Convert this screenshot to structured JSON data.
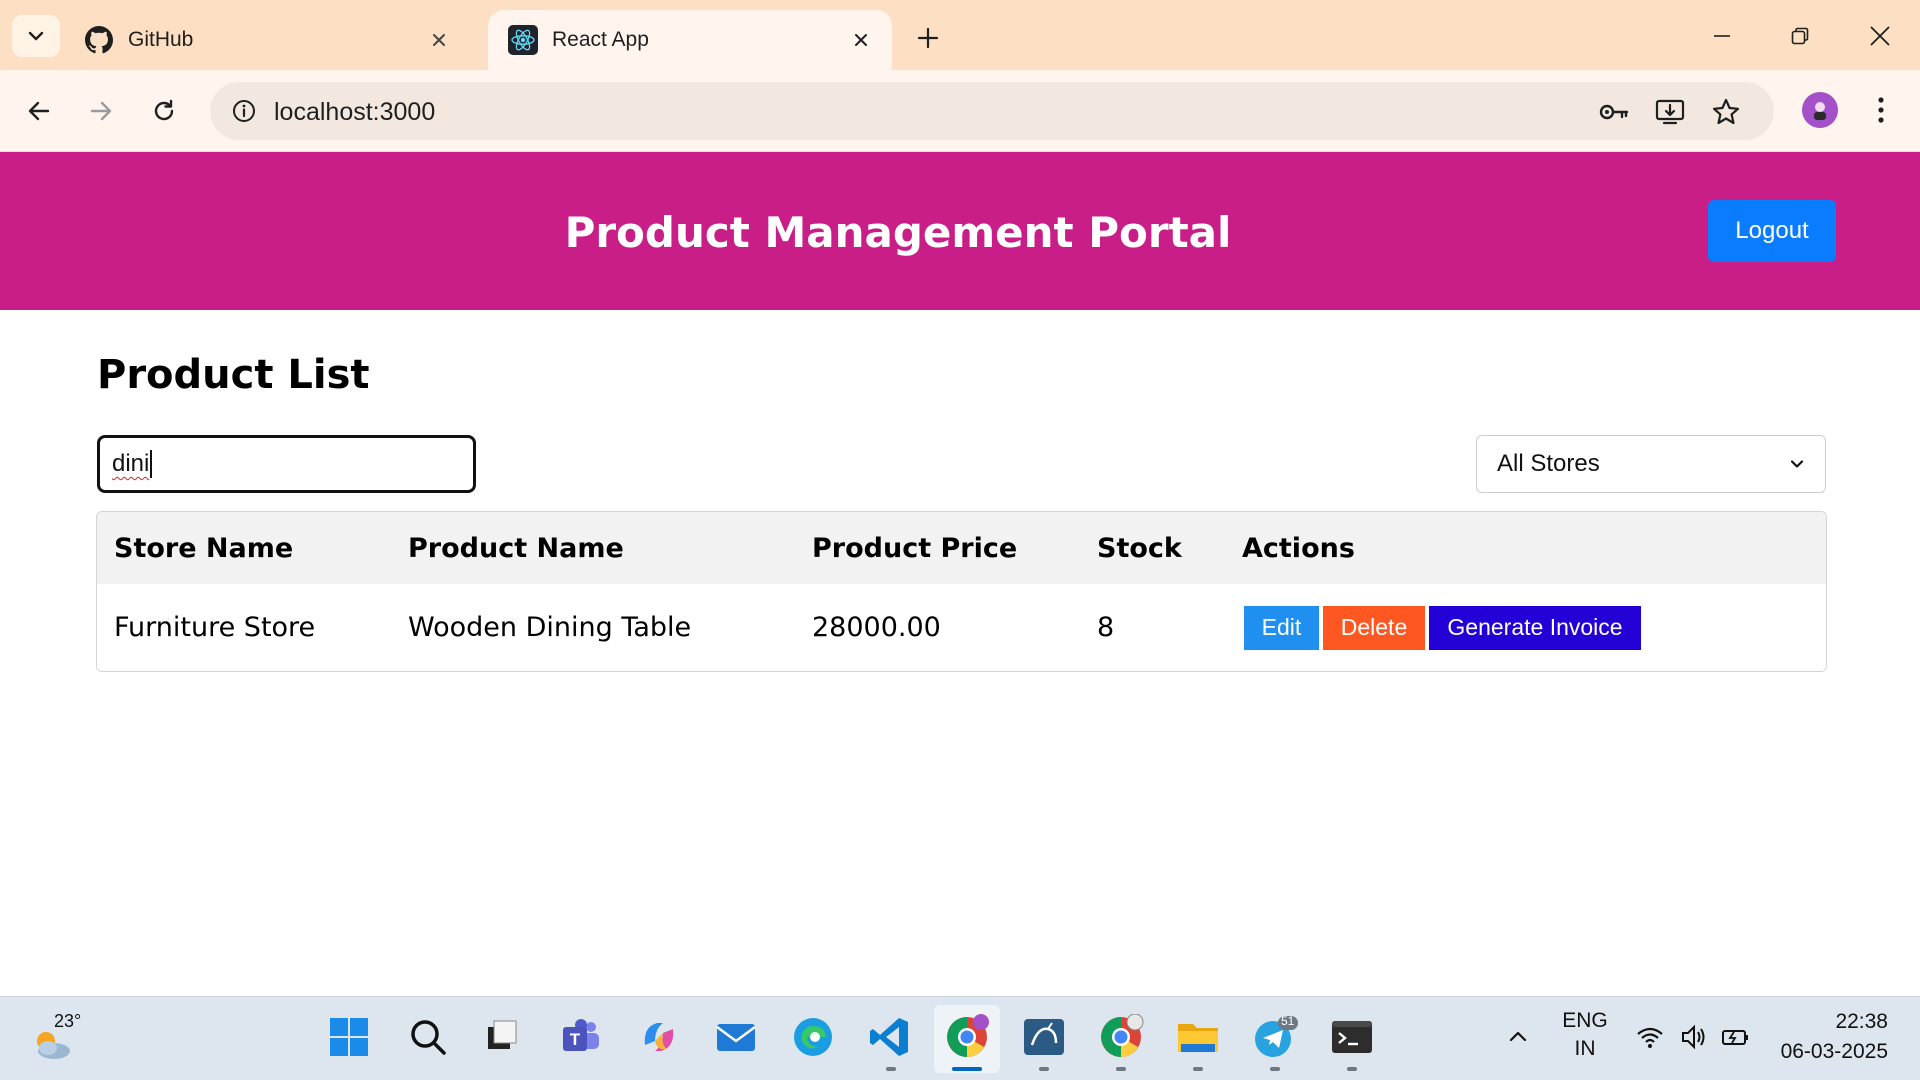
{
  "browser": {
    "tabs": [
      {
        "title": "GitHub",
        "icon": "github-icon",
        "active": false
      },
      {
        "title": "React App",
        "icon": "react-icon",
        "active": true
      }
    ],
    "url": "localhost:3000",
    "colors": {
      "tabbar": "#fde0c3",
      "toolbar": "#fff5ee"
    }
  },
  "header": {
    "title": "Product Management Portal",
    "logout_label": "Logout",
    "colors": {
      "background": "#c91e87",
      "logout": "#0a7cff"
    }
  },
  "main": {
    "heading": "Product List",
    "search": {
      "value": "dini",
      "placeholder": ""
    },
    "store_filter": {
      "selected": "All Stores"
    },
    "table": {
      "columns": [
        "Store Name",
        "Product Name",
        "Product Price",
        "Stock",
        "Actions"
      ],
      "rows": [
        {
          "store": "Furniture Store",
          "product": "Wooden Dining Table",
          "price": "28000.00",
          "stock": "8",
          "actions": {
            "edit": "Edit",
            "delete": "Delete",
            "invoice": "Generate Invoice"
          }
        }
      ]
    },
    "colors": {
      "edit": "#1f8ff0",
      "delete": "#ff5722",
      "invoice": "#2200d6"
    }
  },
  "taskbar": {
    "weather_temp": "23°",
    "language": {
      "line1": "ENG",
      "line2": "IN"
    },
    "time": "22:38",
    "date": "06-03-2025",
    "telegram_badge": "51",
    "apps": [
      "start-icon",
      "search-icon",
      "task-view-icon",
      "teams-icon",
      "copilot-icon",
      "mail-icon",
      "edge-icon",
      "vscode-icon",
      "chrome-icon",
      "mysql-workbench-icon",
      "chrome-icon",
      "file-explorer-icon",
      "telegram-icon",
      "terminal-icon"
    ]
  }
}
